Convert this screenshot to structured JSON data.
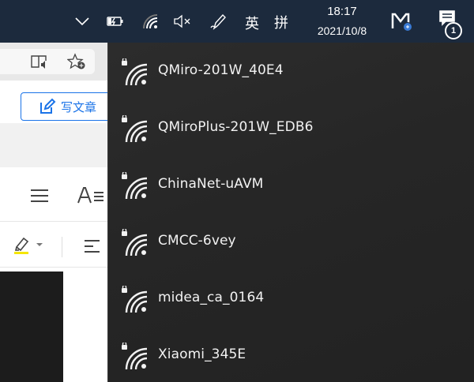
{
  "taskbar": {
    "chevron_icon": "chevron-up-icon",
    "battery_icon": "battery-charging-icon",
    "wifi_icon": "wifi-icon",
    "volume_icon": "volume-muted-icon",
    "pen_icon": "pen-icon",
    "ime_lang": "英",
    "ime_mode": "拼",
    "time": "18:17",
    "date": "2021/10/8",
    "app_icon": "app-logo-icon",
    "notification_icon": "notification-icon",
    "notification_count": "1"
  },
  "browser": {
    "write_button_label": "写文章",
    "reader_icon": "reader-mode-icon",
    "favorite_icon": "add-favorite-icon",
    "menu_icon": "hamburger-menu-icon",
    "text_icon": "text-format-icon",
    "highlight_icon": "highlighter-icon",
    "align_icon": "align-icon"
  },
  "wifi_flyout": {
    "networks": [
      {
        "ssid": "QMiro-201W_40E4",
        "secured": true
      },
      {
        "ssid": "QMiroPlus-201W_EDB6",
        "secured": true
      },
      {
        "ssid": "ChinaNet-uAVM",
        "secured": true
      },
      {
        "ssid": "CMCC-6vey",
        "secured": true
      },
      {
        "ssid": "midea_ca_0164",
        "secured": true
      },
      {
        "ssid": "Xiaomi_345E",
        "secured": true
      }
    ]
  }
}
